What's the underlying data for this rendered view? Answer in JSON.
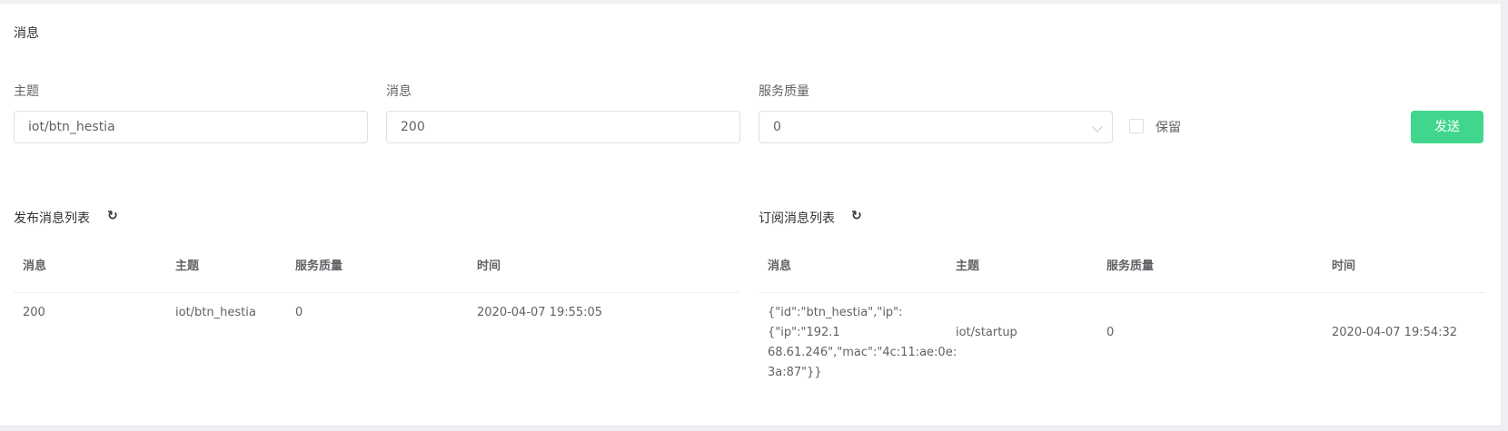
{
  "panel": {
    "title": "消息"
  },
  "form": {
    "topic_label": "主题",
    "topic_value": "iot/btn_hestia",
    "message_label": "消息",
    "message_value": "200",
    "qos_label": "服务质量",
    "qos_value": "0",
    "retain_label": "保留",
    "send_label": "发送"
  },
  "published": {
    "title": "发布消息列表",
    "refresh_icon": "refresh-icon",
    "columns": [
      "消息",
      "主题",
      "服务质量",
      "时间"
    ],
    "rows": [
      {
        "message": "200",
        "topic": "iot/btn_hestia",
        "qos": "0",
        "time": "2020-04-07 19:55:05"
      }
    ]
  },
  "subscribed": {
    "title": "订阅消息列表",
    "refresh_icon": "refresh-icon",
    "columns": [
      "消息",
      "主题",
      "服务质量",
      "时间"
    ],
    "rows": [
      {
        "message_lines": [
          "{\"id\":\"btn_hestia\",\"ip\":{\"ip\":\"192.1",
          "68.61.246\",\"mac\":\"4c:11:ae:0e:",
          "3a:87\"}}"
        ],
        "topic": "iot/startup",
        "qos": "0",
        "time": "2020-04-07 19:54:32"
      }
    ]
  },
  "colors": {
    "accent": "#41d68d",
    "background": "#eef0f3",
    "panel": "#ffffff"
  }
}
